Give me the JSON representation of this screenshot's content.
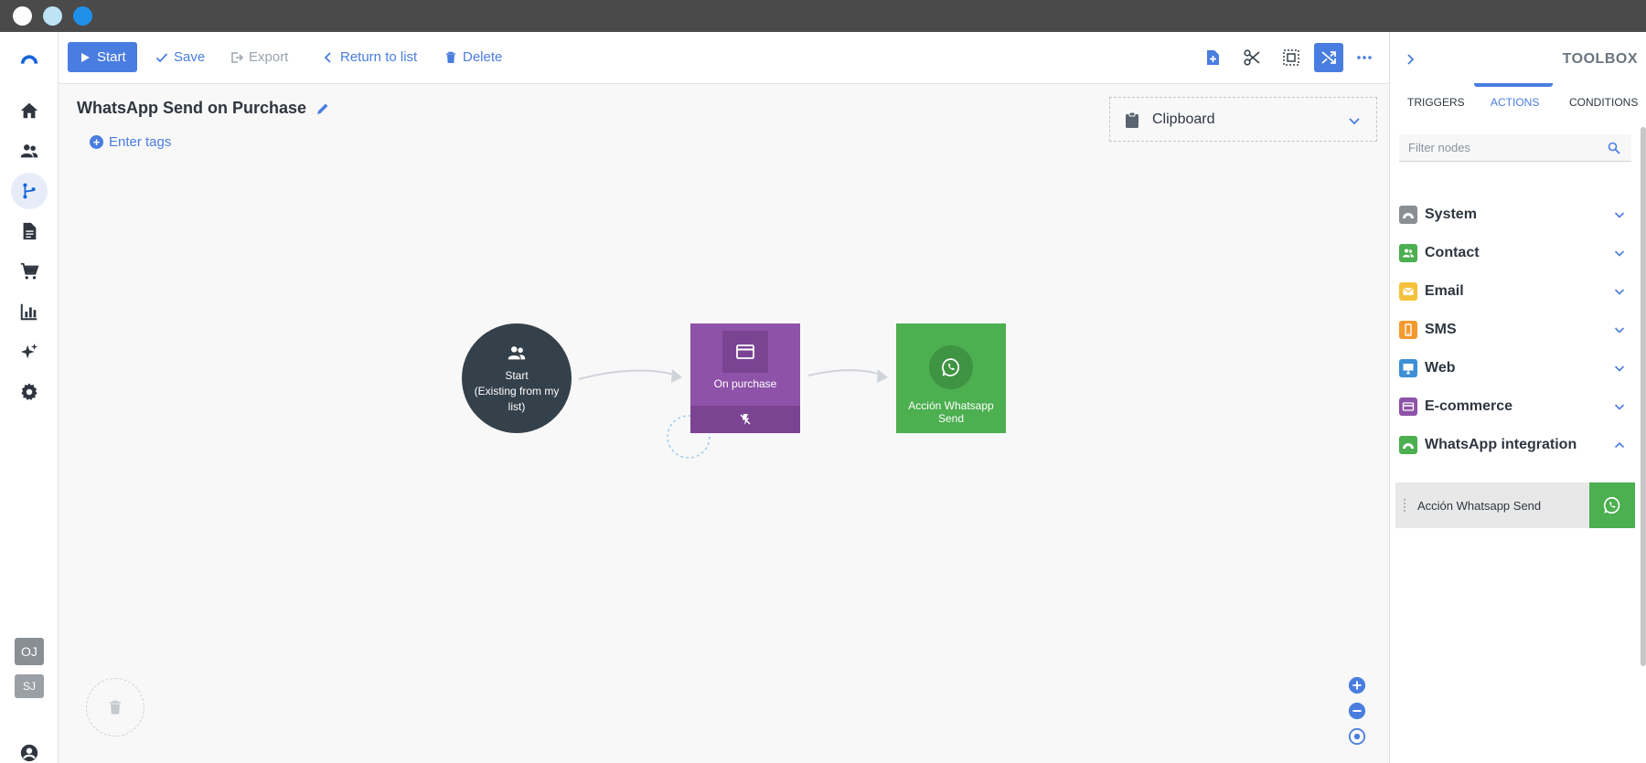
{
  "window": {
    "dots": [
      "#ffffff",
      "#bde3f5",
      "#1e90e8"
    ]
  },
  "nav": {
    "items": [
      {
        "name": "home-icon",
        "active": false
      },
      {
        "name": "contacts-icon",
        "active": false
      },
      {
        "name": "automation-icon",
        "active": true
      },
      {
        "name": "document-icon",
        "active": false
      },
      {
        "name": "cart-icon",
        "active": false
      },
      {
        "name": "reports-icon",
        "active": false
      },
      {
        "name": "sparkle-icon",
        "active": false
      },
      {
        "name": "settings-icon",
        "active": false
      }
    ],
    "badges": [
      "OJ",
      "SJ"
    ]
  },
  "toolbar": {
    "start_label": "Start",
    "save_label": "Save",
    "export_label": "Export",
    "return_label": "Return to list",
    "delete_label": "Delete"
  },
  "workflow": {
    "title": "WhatsApp Send on Purchase",
    "tags_label": "Enter tags",
    "clipboard_label": "Clipboard"
  },
  "nodes": {
    "start": {
      "title": "Start",
      "subtitle": "(Existing from my list)"
    },
    "purchase": {
      "label": "On purchase"
    },
    "whatsapp": {
      "label": "Acción Whatsapp Send"
    }
  },
  "toolbox": {
    "title": "TOOLBOX",
    "tabs": [
      {
        "label": "TRIGGERS",
        "active": false
      },
      {
        "label": "ACTIONS",
        "active": true
      },
      {
        "label": "CONDITIONS",
        "active": false
      }
    ],
    "filter_placeholder": "Filter nodes",
    "categories": [
      {
        "label": "System",
        "color": "#8a8f96",
        "expanded": false
      },
      {
        "label": "Contact",
        "color": "#4caf50",
        "expanded": false
      },
      {
        "label": "Email",
        "color": "#f4c23a",
        "expanded": false
      },
      {
        "label": "SMS",
        "color": "#f29a2e",
        "expanded": false
      },
      {
        "label": "Web",
        "color": "#3d8fd6",
        "expanded": false
      },
      {
        "label": "E-commerce",
        "color": "#8e52a8",
        "expanded": false
      },
      {
        "label": "WhatsApp integration",
        "color": "#4caf50",
        "expanded": true
      }
    ],
    "actions": [
      {
        "label": "Acción Whatsapp Send"
      }
    ]
  },
  "colors": {
    "accent": "#4a7de0",
    "start_node": "#34404a",
    "purchase_node": "#8e52a8",
    "whatsapp_node": "#4caf50"
  }
}
